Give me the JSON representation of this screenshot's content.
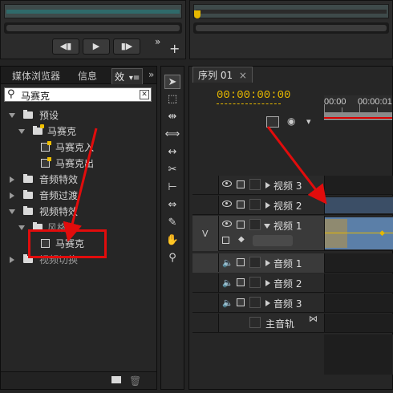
{
  "colors": {
    "accent_timecode": "#e6b800",
    "annotation_red": "#e10c0c",
    "clip_blue": "#5b7fa8"
  },
  "top_left_monitor": {
    "icons": [
      "step-back-icon",
      "play-icon",
      "step-forward-icon",
      "more-icon"
    ],
    "glyphs": {
      "more": "»",
      "add": "+"
    }
  },
  "top_right_monitor": {
    "icons": [
      "playhead-icon"
    ]
  },
  "project_panel": {
    "tabs": [
      {
        "label": "媒体浏览器"
      },
      {
        "label": "信息"
      },
      {
        "label": "效"
      }
    ],
    "tab_menu_glyph": "▾≡",
    "search": {
      "value": "马赛克"
    },
    "tree": [
      {
        "label": "预设",
        "type": "folder"
      },
      {
        "label": "马赛克",
        "type": "preset-folder"
      },
      {
        "label": "马赛克入",
        "type": "effect"
      },
      {
        "label": "马赛克出",
        "type": "effect"
      },
      {
        "label": "音频特效",
        "type": "folder"
      },
      {
        "label": "音频过渡",
        "type": "folder"
      },
      {
        "label": "视频特效",
        "type": "folder"
      },
      {
        "label": "风格化",
        "type": "folder"
      },
      {
        "label": "马赛克",
        "type": "effect"
      },
      {
        "label": "视频切换",
        "type": "folder"
      }
    ]
  },
  "tools": [
    "selection-tool-icon",
    "track-select-icon",
    "ripple-edit-icon",
    "rolling-edit-icon",
    "rate-stretch-icon",
    "razor-icon",
    "slip-icon",
    "slide-icon",
    "pen-icon",
    "hand-icon",
    "zoom-icon"
  ],
  "sequence": {
    "tab_label": "序列 01",
    "close_glyph": "×",
    "timecode": "00:00:00:00",
    "ruler_labels": [
      "00:00",
      "00:00:01"
    ],
    "video_target_label": "V",
    "tracks": [
      {
        "name": "视频 3",
        "kind": "video",
        "expanded": false
      },
      {
        "name": "视频 2",
        "kind": "video",
        "expanded": false
      },
      {
        "name": "视频 1",
        "kind": "video",
        "expanded": true
      },
      {
        "name": "音频 1",
        "kind": "audio",
        "expanded": false
      },
      {
        "name": "音频 2",
        "kind": "audio",
        "expanded": false
      },
      {
        "name": "音频 3",
        "kind": "audio",
        "expanded": false
      },
      {
        "name": "主音轨",
        "kind": "master",
        "expanded": false
      }
    ],
    "master_glyph": "⋈"
  }
}
